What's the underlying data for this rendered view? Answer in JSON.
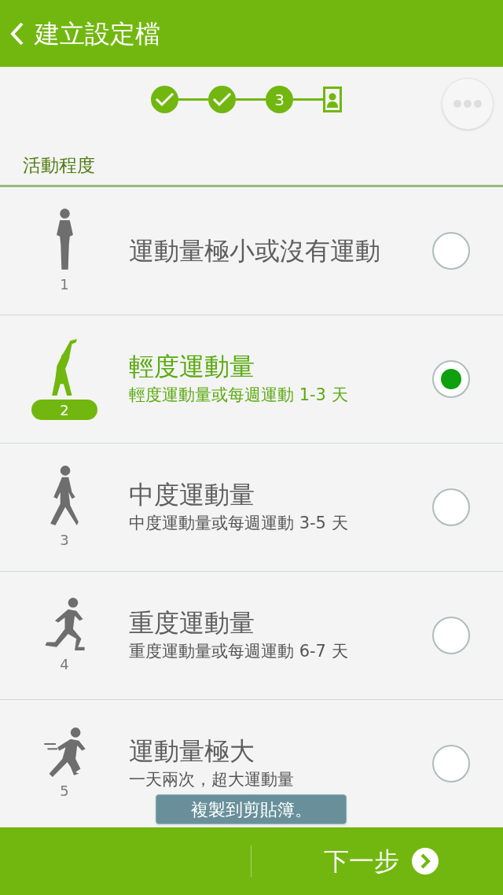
{
  "header": {
    "title": "建立設定檔"
  },
  "steps": [
    {
      "kind": "done"
    },
    {
      "kind": "done"
    },
    {
      "kind": "current",
      "label": "3"
    },
    {
      "kind": "profile"
    }
  ],
  "section_title": "活動程度",
  "levels": [
    {
      "kind": "standing",
      "number": "1",
      "title": "運動量極小或沒有運動",
      "selected": false
    },
    {
      "kind": "stretching",
      "number": "2",
      "title": "輕度運動量",
      "subtitle": "輕度運動量或每週運動 1-3 天",
      "selected": true
    },
    {
      "kind": "walking",
      "number": "3",
      "title": "中度運動量",
      "subtitle": "中度運動量或每週運動 3-5 天",
      "selected": false
    },
    {
      "kind": "running",
      "number": "4",
      "title": "重度運動量",
      "subtitle": "重度運動量或每週運動 6-7 天",
      "selected": false
    },
    {
      "kind": "sprinting",
      "number": "5",
      "title": "運動量極大",
      "subtitle": "一天兩次，超大運動量",
      "selected": false
    }
  ],
  "toast": {
    "text": "複製到剪貼簿。"
  },
  "next_button": {
    "label": "下一步"
  }
}
